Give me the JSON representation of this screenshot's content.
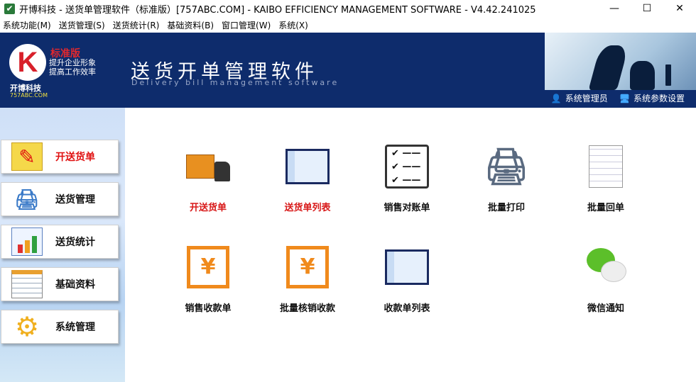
{
  "window": {
    "title": "开博科技 - 送货单管理软件（标准版）[757ABC.COM] - KAIBO EFFICIENCY MANAGEMENT SOFTWARE - V4.42.241025",
    "minimize": "—",
    "maximize": "☐",
    "close": "✕"
  },
  "menu": [
    "系统功能(M)",
    "送货管理(S)",
    "送货统计(R)",
    "基础资料(B)",
    "窗口管理(W)",
    "系统(X)"
  ],
  "banner": {
    "logo_letter": "K",
    "edition": "标准版",
    "slogan1": "提升企业形象",
    "slogan2": "提高工作效率",
    "company": "开博科技",
    "site": "757ABC.COM",
    "title": "送货开单管理软件",
    "subtitle": "Delivery bill management software",
    "user": "系统管理员",
    "settings": "系统参数设置"
  },
  "sidebar": [
    {
      "label": "开送货单",
      "icon": "notepad-pencil-icon"
    },
    {
      "label": "送货管理",
      "icon": "printer-icon"
    },
    {
      "label": "送货统计",
      "icon": "bar-chart-icon"
    },
    {
      "label": "基础资料",
      "icon": "spreadsheet-icon"
    },
    {
      "label": "系统管理",
      "icon": "gear-icon"
    }
  ],
  "tiles": [
    {
      "label": "开送货单",
      "icon": "truck-icon"
    },
    {
      "label": "送货单列表",
      "icon": "list-window-icon"
    },
    {
      "label": "销售对账单",
      "icon": "checklist-icon"
    },
    {
      "label": "批量打印",
      "icon": "printer-icon"
    },
    {
      "label": "批量回单",
      "icon": "document-pencil-icon"
    },
    {
      "label": "销售收款单",
      "icon": "yen-receipt-icon"
    },
    {
      "label": "批量核销收款",
      "icon": "yen-receipt-icon"
    },
    {
      "label": "收款单列表",
      "icon": "list-window-icon"
    },
    {
      "label": "微信通知",
      "icon": "wechat-icon"
    }
  ],
  "colors": {
    "banner": "#0e2c6c",
    "active": "#e01010",
    "icon_orange": "#f08a1c"
  }
}
